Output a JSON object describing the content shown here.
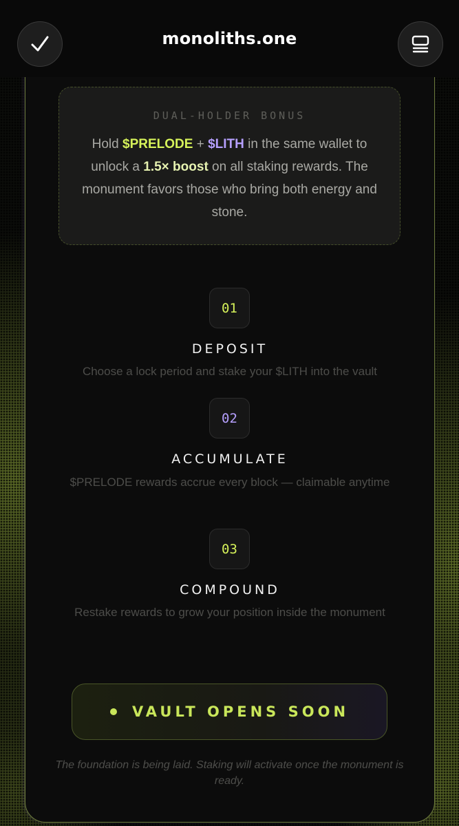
{
  "topbar": {
    "url": "monoliths.one",
    "left_icon": "check-icon",
    "right_icon": "tabs-icon"
  },
  "bonus": {
    "title": "DUAL-HOLDER BONUS",
    "text_1": "Hold ",
    "token_1": "$PRELODE",
    "text_2": " + ",
    "token_2": "$LITH",
    "text_3": " in the same wallet to unlock a ",
    "boost": "1.5× boost",
    "text_4": " on all staking rewards. The monument favors those who bring both energy and stone."
  },
  "steps": [
    {
      "num": "01",
      "title": "DEPOSIT",
      "desc": "Choose a lock period and stake your $LITH into the vault",
      "num_color": "#d6f25a"
    },
    {
      "num": "02",
      "title": "ACCUMULATE",
      "desc": "$PRELODE rewards accrue every block — claimable anytime",
      "num_color": "#b6a0ff"
    },
    {
      "num": "03",
      "title": "COMPOUND",
      "desc": "Restake rewards to grow your position inside the monument",
      "num_color": "#d6f25a"
    }
  ],
  "vault_button": {
    "label": "VAULT OPENS SOON"
  },
  "footnote": "The foundation is being laid. Staking will activate once the monument is ready.",
  "colors": {
    "accent_green": "#c9e65a",
    "accent_purple": "#b6a0ff"
  }
}
